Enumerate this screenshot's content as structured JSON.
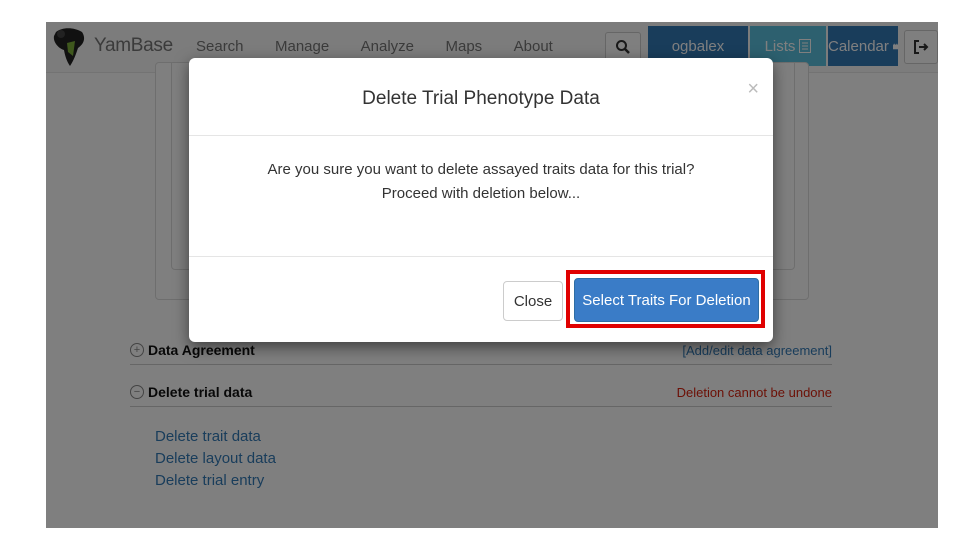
{
  "navbar": {
    "brand": "YamBase",
    "links": [
      "Search",
      "Manage",
      "Analyze",
      "Maps",
      "About"
    ],
    "user": "ogbalex",
    "lists": "Lists",
    "calendar": "Calendar"
  },
  "sections": {
    "data_agreement": {
      "toggle": "+",
      "title": "Data Agreement",
      "link": "[Add/edit data agreement]"
    },
    "delete_trial": {
      "toggle": "−",
      "title": "Delete trial data",
      "warning": "Deletion cannot be undone"
    }
  },
  "delete_links": [
    "Delete trait data",
    "Delete layout data",
    "Delete trial entry"
  ],
  "modal": {
    "title": "Delete Trial Phenotype Data",
    "close_x": "×",
    "body_line1": "Are you sure you want to delete assayed traits data for this trial?",
    "body_line2": "Proceed with deletion below...",
    "close_button": "Close",
    "select_button": "Select Traits For Deletion"
  },
  "colors": {
    "primary": "#337ab7",
    "info": "#5bc0de",
    "highlight": "#e00000",
    "warning_text": "#d9230f"
  }
}
